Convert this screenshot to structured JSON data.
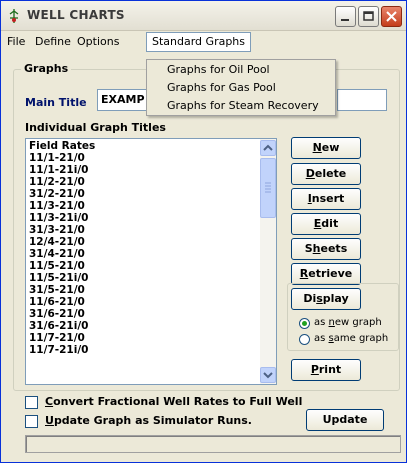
{
  "window": {
    "title": "WELL CHARTS",
    "icon": "well-chart-icon"
  },
  "menu": {
    "file": "File",
    "define": "Define",
    "options": "Options",
    "standard_graphs": "Standard Graphs",
    "standard_graphs_items": [
      "Graphs for Oil Pool",
      "Graphs for Gas Pool",
      "Graphs for Steam Recovery"
    ]
  },
  "graphs": {
    "legend": "Graphs",
    "main_title_label": "Main Title",
    "main_title_value": "EXAMP",
    "individual_titles_label": "Individual Graph Titles",
    "titles": [
      "Field Rates",
      "11/1-21/0",
      "11/1-21i/0",
      "11/2-21/0",
      "31/2-21/0",
      "11/3-21/0",
      "11/3-21i/0",
      "31/3-21/0",
      "12/4-21/0",
      "31/4-21/0",
      "11/5-21/0",
      "11/5-21i/0",
      "31/5-21/0",
      "11/6-21/0",
      "31/6-21/0",
      "31/6-21i/0",
      "11/7-21/0",
      "11/7-21i/0"
    ]
  },
  "buttons": {
    "new_u": "N",
    "new_rest": "ew",
    "delete_u": "D",
    "delete_rest": "elete",
    "insert_u": "I",
    "insert_rest": "nsert",
    "edit_u": "E",
    "edit_rest": "dit",
    "sheets_pre": "S",
    "sheets_u": "h",
    "sheets_rest": "eets",
    "retrieve_u": "R",
    "retrieve_rest": "etrieve",
    "display_pre": "Di",
    "display_u": "s",
    "display_rest": "play",
    "print_u": "P",
    "print_rest": "rint",
    "update": "Update"
  },
  "display_options": {
    "new_graph_pre": "as ",
    "new_graph_u": "n",
    "new_graph_rest": "ew graph",
    "same_graph_pre": "as ",
    "same_graph_u": "s",
    "same_graph_rest": "ame graph",
    "selected": "new"
  },
  "checks": {
    "convert_u": "C",
    "convert_rest": "onvert Fractional Well Rates to Full Well",
    "update_u": "U",
    "update_rest": "pdate Graph as Simulator Runs."
  },
  "status_text": ""
}
